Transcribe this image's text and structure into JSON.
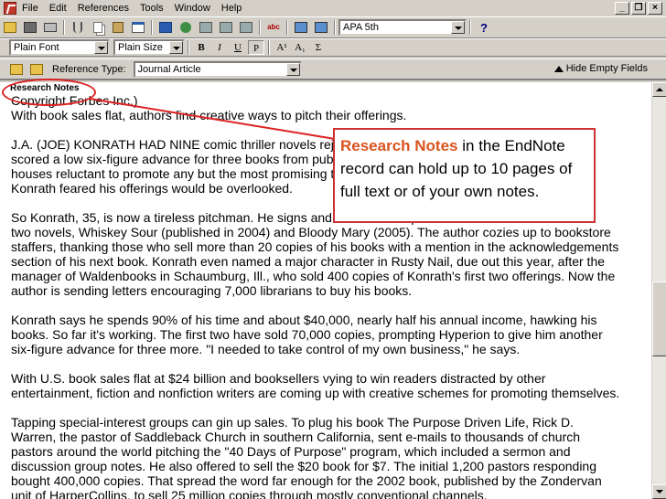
{
  "menubar": {
    "items": [
      "File",
      "Edit",
      "References",
      "Tools",
      "Window",
      "Help"
    ],
    "window_controls": [
      "_",
      "×"
    ]
  },
  "toolbar1": {
    "style_value": "APA 5th",
    "help_label": "?",
    "spell_label": "abc"
  },
  "toolbar2": {
    "font_value": "Plain Font",
    "size_value": "Plain Size",
    "format_buttons": [
      "B",
      "I",
      "U",
      "P",
      "A¹",
      "A₁",
      "Σ"
    ]
  },
  "toolbar3": {
    "reference_type_label": "Reference Type:",
    "reference_type_value": "Journal Article",
    "hide_empty_label": "Hide Empty Fields"
  },
  "content": {
    "field_label": "Research Notes",
    "paragraphs": [
      "Copyright Forbes Inc.)\nWith book sales flat, authors find creative ways to pitch their offerings.",
      "J.A. (JOE) KONRATH HAD NINE comic thriller novels rejected before he\nscored a low six-figure advance for three books from publisher Hyperion. With publishing\nhouses reluctant to promote any but the most promising titles and authors, however,\nKonrath feared his offerings would be overlooked.",
      "So Konrath, 35, is now a tireless pitchman. He signs and distributes copies of his first\ntwo novels, Whiskey Sour (published in 2004) and Bloody Mary (2005). The author cozies up to bookstore\nstaffers, thanking those who sell more than 20 copies of his books with a mention in the acknowledgements\nsection of his next book. Konrath even named a major character in Rusty Nail, due out this year, after the\nmanager of Waldenbooks in Schaumburg, Ill., who sold 400 copies of Konrath's first two offerings. Now the\nauthor is sending letters encouraging 7,000 librarians to buy his books.",
      "Konrath says he spends 90% of his time and about $40,000, nearly half his annual income, hawking his\nbooks. So far it's working. The first two have sold 70,000 copies, prompting Hyperion to give him another\nsix-figure advance for three more. \"I needed to take control of my own business,\" he says.",
      "With U.S. book sales flat at $24 billion and booksellers vying to win readers distracted by other\nentertainment, fiction and nonfiction writers are coming up with creative schemes for promoting themselves.",
      "Tapping special-interest groups can gin up sales. To plug his book The Purpose Driven Life, Rick D.\nWarren, the pastor of Saddleback Church in southern California, sent e-mails to thousands of church\npastors around the world pitching the \"40 Days of Purpose\" program, which included a sermon and\ndiscussion group notes. He also offered to sell the $20 book for $7. The initial 1,200 pastors responding\nbought 400,000 copies. That spread the word far enough for the 2002 book, published by the Zondervan\nunit of HarperCollins, to sell 25 million copies through mostly conventional channels."
    ]
  },
  "callout": {
    "title": "Research Notes",
    "body": " in the EndNote record can hold up to 10 pages of full text or of your own notes.",
    "color_title": "#d9531e",
    "color_border": "#cc3333"
  }
}
